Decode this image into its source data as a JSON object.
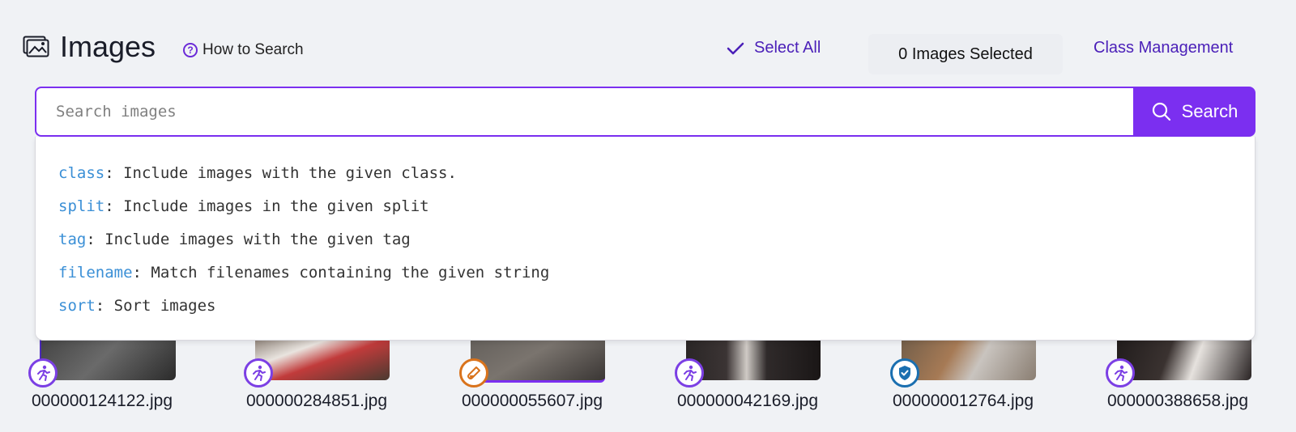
{
  "header": {
    "title": "Images",
    "how_to_search": "How to Search",
    "select_all": "Select All",
    "images_selected": "0 Images Selected",
    "class_management": "Class Management"
  },
  "search": {
    "placeholder": "Search images",
    "button_label": "Search",
    "options": [
      {
        "key": "class",
        "desc": ": Include images with the given class."
      },
      {
        "key": "split",
        "desc": ": Include images in the given split"
      },
      {
        "key": "tag",
        "desc": ": Include images with the given tag"
      },
      {
        "key": "filename",
        "desc": ": Match filenames containing the given string"
      },
      {
        "key": "sort",
        "desc": ": Sort images"
      }
    ]
  },
  "images": [
    {
      "filename": "000000124122.jpg",
      "badge_icon": "running-person-icon",
      "badge_color": "#7b3fe4"
    },
    {
      "filename": "000000284851.jpg",
      "badge_icon": "running-person-icon",
      "badge_color": "#7b3fe4"
    },
    {
      "filename": "000000055607.jpg",
      "badge_icon": "test-tube-icon",
      "badge_color": "#d9731c"
    },
    {
      "filename": "000000042169.jpg",
      "badge_icon": "running-person-icon",
      "badge_color": "#7b3fe4"
    },
    {
      "filename": "000000012764.jpg",
      "badge_icon": "shield-check-icon",
      "badge_color": "#1a6fb0"
    },
    {
      "filename": "000000388658.jpg",
      "badge_icon": "running-person-icon",
      "badge_color": "#7b3fe4"
    }
  ],
  "colors": {
    "accent": "#7b2ff0",
    "link": "#4a1fb8",
    "option_key": "#3a8fd6",
    "background": "#f0f2f5"
  }
}
